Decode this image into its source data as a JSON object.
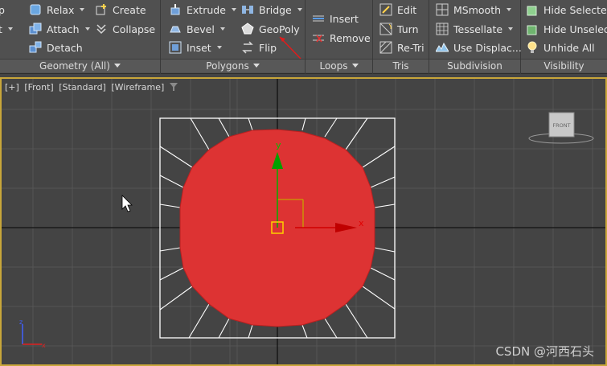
{
  "ribbon": {
    "geometry": {
      "title": "Geometry (All)",
      "buttons": [
        "p",
        "t",
        "Relax",
        "Attach",
        "Detach",
        "Create",
        "Collapse"
      ]
    },
    "polygons": {
      "title": "Polygons",
      "buttons": [
        "Extrude",
        "Bevel",
        "Inset",
        "Bridge",
        "GeoPoly",
        "Flip"
      ]
    },
    "loops": {
      "title": "Loops",
      "buttons": [
        "Insert",
        "Remove"
      ]
    },
    "tris": {
      "title": "Tris",
      "buttons": [
        "Edit",
        "Turn",
        "Re-Tri"
      ]
    },
    "subdivision": {
      "title": "Subdivision",
      "buttons": [
        "MSmooth",
        "Tessellate",
        "Use Displac..."
      ]
    },
    "visibility": {
      "title": "Visibility",
      "buttons": [
        "Hide Selected",
        "Hide Unselect",
        "Unhide All"
      ]
    }
  },
  "viewport": {
    "labels": [
      "[+]",
      "[Front]",
      "[Standard]",
      "[Wireframe]"
    ],
    "viewcube_label": "FRONT",
    "gizmo_axes": [
      "y",
      "x"
    ],
    "mini_axes": [
      "z",
      "x"
    ],
    "object_color": "#dd3333",
    "active_border_color": "#c8a63a"
  },
  "watermark": "CSDN @河西石头"
}
